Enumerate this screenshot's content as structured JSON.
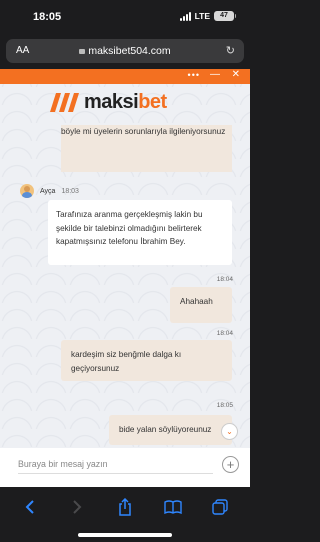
{
  "status_bar": {
    "time": "18:05",
    "network": "LTE",
    "battery": "47"
  },
  "browser": {
    "text_size_label": "AA",
    "url": "maksibet504.com"
  },
  "chat": {
    "header_menu_glyph": "•••",
    "logo_prefix": "maksi",
    "logo_suffix": "bet",
    "messages": [
      {
        "from": "agent",
        "text": "böyle mi üyelerin sorunlarıyla ilgileniyorsunuz"
      },
      {
        "from": "agent",
        "name": "Ayça",
        "time": "18:03",
        "text": "Tarafınıza aranma gerçekleşmiş lakin bu şekilde bir talebinzi olmadığını belirterek kapatmışsınız telefonu İbrahim Bey."
      },
      {
        "from": "user",
        "time": "18:04",
        "text": "Ahahaah"
      },
      {
        "from": "user",
        "time": "18:04",
        "text": "kardeşim siz benğmle dalga kı geçiyorsunuz"
      },
      {
        "from": "user",
        "time": "18:05",
        "text": "bide yalan söylüyoreunuz"
      }
    ],
    "composer_placeholder": "Buraya bir mesaj yazın"
  },
  "colors": {
    "brand": "#f37021",
    "user_bubble": "#f1e7dd",
    "ios_blue": "#2f86ff"
  }
}
